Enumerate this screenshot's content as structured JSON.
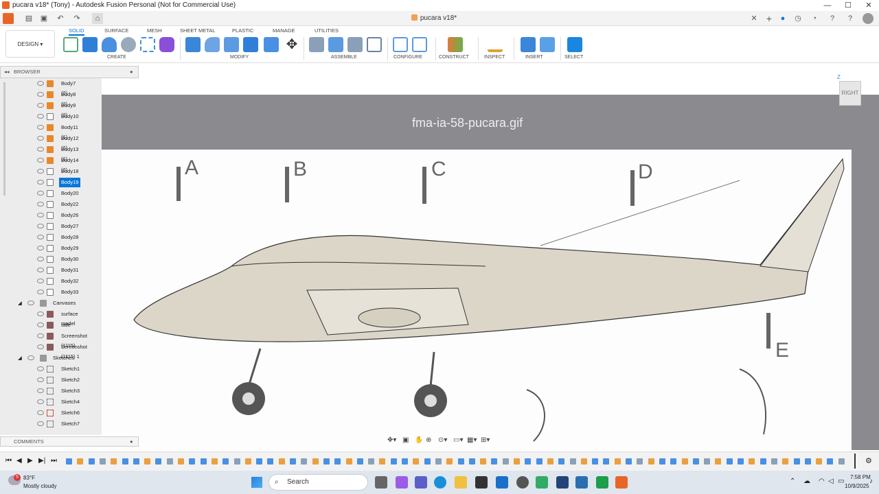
{
  "window": {
    "title": "pucara v18* (Tony) - Autodesk Fusion Personal (Not for Commercial Use)"
  },
  "doc_tab": {
    "title": "pucara v18*"
  },
  "ribbon": {
    "design_label": "DESIGN",
    "tabs": [
      "SOLID",
      "SURFACE",
      "MESH",
      "SHEET METAL",
      "PLASTIC",
      "MANAGE",
      "UTILITIES"
    ],
    "groups": [
      "CREATE",
      "MODIFY",
      "ASSEMBLE",
      "CONFIGURE",
      "CONSTRUCT",
      "INSPECT",
      "INSERT",
      "SELECT"
    ]
  },
  "browser": {
    "title": "BROWSER",
    "items": [
      {
        "label": "Body7 (2)",
        "type": "component"
      },
      {
        "label": "Body8 (2)",
        "type": "component"
      },
      {
        "label": "Body9 (2)",
        "type": "component"
      },
      {
        "label": "Body10",
        "type": "body"
      },
      {
        "label": "Body11 (1)",
        "type": "component"
      },
      {
        "label": "Body12 (2)",
        "type": "component"
      },
      {
        "label": "Body13 (1)",
        "type": "component"
      },
      {
        "label": "Body14 (2)",
        "type": "component"
      },
      {
        "label": "Body18",
        "type": "body"
      },
      {
        "label": "Body19",
        "type": "body",
        "selected": true
      },
      {
        "label": "Body20",
        "type": "body"
      },
      {
        "label": "Body22",
        "type": "body"
      },
      {
        "label": "Body26",
        "type": "body"
      },
      {
        "label": "Body27",
        "type": "body"
      },
      {
        "label": "Body28",
        "type": "body"
      },
      {
        "label": "Body29",
        "type": "body"
      },
      {
        "label": "Body30",
        "type": "body"
      },
      {
        "label": "Body31",
        "type": "body"
      },
      {
        "label": "Body32",
        "type": "body"
      },
      {
        "label": "Body33",
        "type": "body"
      },
      {
        "label": "Canvases",
        "type": "folder"
      },
      {
        "label": "surface model",
        "type": "canvas"
      },
      {
        "label": "side",
        "type": "canvas"
      },
      {
        "label": "Screenshot (1115)",
        "type": "canvas"
      },
      {
        "label": "Screenshot (1115) 1",
        "type": "canvas"
      },
      {
        "label": "Sketches",
        "type": "folder"
      },
      {
        "label": "Sketch1",
        "type": "sketch"
      },
      {
        "label": "Sketch2",
        "type": "sketch"
      },
      {
        "label": "Sketch3",
        "type": "sketch"
      },
      {
        "label": "Sketch4",
        "type": "sketch"
      },
      {
        "label": "Sketch6",
        "type": "sketch"
      },
      {
        "label": "Sketch7",
        "type": "sketch"
      }
    ]
  },
  "comments": {
    "title": "COMMENTS"
  },
  "canvas": {
    "image_name": "fma-ia-58-pucara.gif",
    "section_labels": [
      "A",
      "B",
      "C",
      "D",
      "E"
    ],
    "viewcube_label": "RIGHT",
    "axis_label": "Z"
  },
  "taskbar": {
    "weather_temp": "83°F",
    "weather_desc": "Mostly cloudy",
    "search_placeholder": "Search",
    "time": "7:58 PM",
    "date": "10/9/2025",
    "notification_count": "5"
  },
  "colors": {
    "accent": "#0b77d8",
    "fusion_orange": "#e8652a",
    "canvas_bg": "#8a8a8f"
  }
}
